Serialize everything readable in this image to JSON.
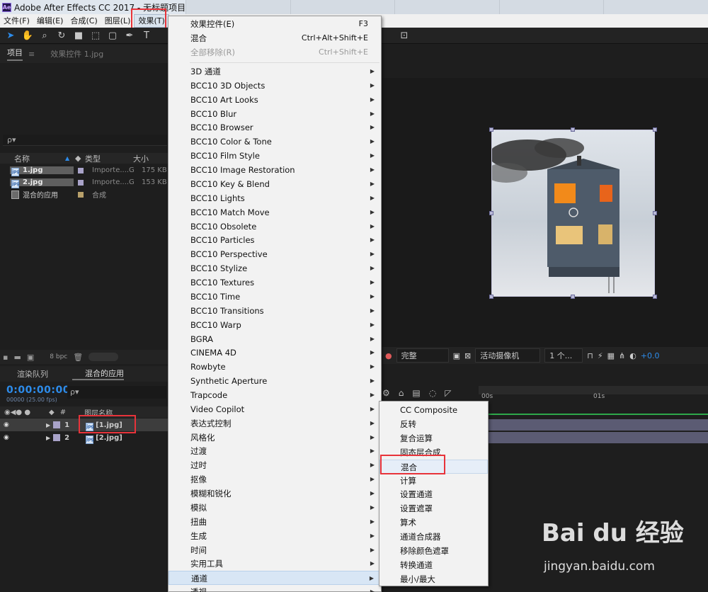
{
  "window": {
    "title": "Adobe After Effects CC 2017 - 无标题项目.aep *",
    "app_icon": "Ae"
  },
  "menubar": {
    "items": [
      "文件(F)",
      "编辑(E)",
      "合成(C)",
      "图层(L)",
      "效果(T)"
    ]
  },
  "project_panel": {
    "tab": "项目",
    "effects_tab": "效果控件 1.jpg",
    "search_placeholder": "ρ▾",
    "columns": {
      "name": "名称",
      "type": "类型",
      "size": "大小"
    },
    "items": [
      {
        "name": "1.jpg",
        "type": "Importe....G",
        "size": "175 KB",
        "swatch": "#a9a3c9"
      },
      {
        "name": "2.jpg",
        "type": "Importe....G",
        "size": "153 KB",
        "swatch": "#a9a3c9"
      },
      {
        "name": "混合的应用",
        "type": "合成",
        "size": "",
        "swatch": "#b8a06a"
      }
    ],
    "footer_bpc": "8 bpc"
  },
  "viewer_bar": {
    "quality": "完整",
    "camera": "活动摄像机",
    "views": "1 个...",
    "exposure": "+0.0"
  },
  "timeline": {
    "render_tab": "渲染队列",
    "comp_tab": "混合的应用",
    "timecode": "0:00:00:00",
    "fps": "00000 (25.00 fps)",
    "search_placeholder": "ρ▾",
    "col_layer_name": "图层名称",
    "col_hash": "#",
    "ruler_start": "00s",
    "ruler_mark": "01s",
    "layers": [
      {
        "num": "1",
        "name": "[1.jpg]"
      },
      {
        "num": "2",
        "name": "[2.jpg]"
      }
    ]
  },
  "effect_menu": {
    "top_items": [
      {
        "label": "效果控件(E)",
        "shortcut": "F3"
      },
      {
        "label": "混合",
        "shortcut": "Ctrl+Alt+Shift+E"
      },
      {
        "label": "全部移除(R)",
        "shortcut": "Ctrl+Shift+E"
      }
    ],
    "categories": [
      "3D 通道",
      "BCC10 3D Objects",
      "BCC10 Art Looks",
      "BCC10 Blur",
      "BCC10 Browser",
      "BCC10 Color & Tone",
      "BCC10 Film Style",
      "BCC10 Image Restoration",
      "BCC10 Key & Blend",
      "BCC10 Lights",
      "BCC10 Match Move",
      "BCC10 Obsolete",
      "BCC10 Particles",
      "BCC10 Perspective",
      "BCC10 Stylize",
      "BCC10 Textures",
      "BCC10 Time",
      "BCC10 Transitions",
      "BCC10 Warp",
      "BGRA",
      "CINEMA 4D",
      "Rowbyte",
      "Synthetic Aperture",
      "Trapcode",
      "Video Copilot",
      "表达式控制",
      "风格化",
      "过渡",
      "过时",
      "抠像",
      "模糊和锐化",
      "模拟",
      "扭曲",
      "生成",
      "时间",
      "实用工具",
      "通道",
      "透视"
    ],
    "hovered_category": "通道"
  },
  "channel_submenu": {
    "items": [
      "CC Composite",
      "反转",
      "复合运算",
      "固态层合成",
      "混合",
      "计算",
      "设置通道",
      "设置遮罩",
      "算术",
      "通道合成器",
      "移除颜色遮罩",
      "转换通道",
      "最小/最大"
    ],
    "hovered": "混合"
  },
  "watermark": {
    "brand": "Bai du 经验",
    "url": "jingyan.baidu.com"
  },
  "colors": {
    "accent": "#2d8ceb",
    "highlight_box": "#e8333a",
    "menu_bg": "#f2f2f2"
  }
}
